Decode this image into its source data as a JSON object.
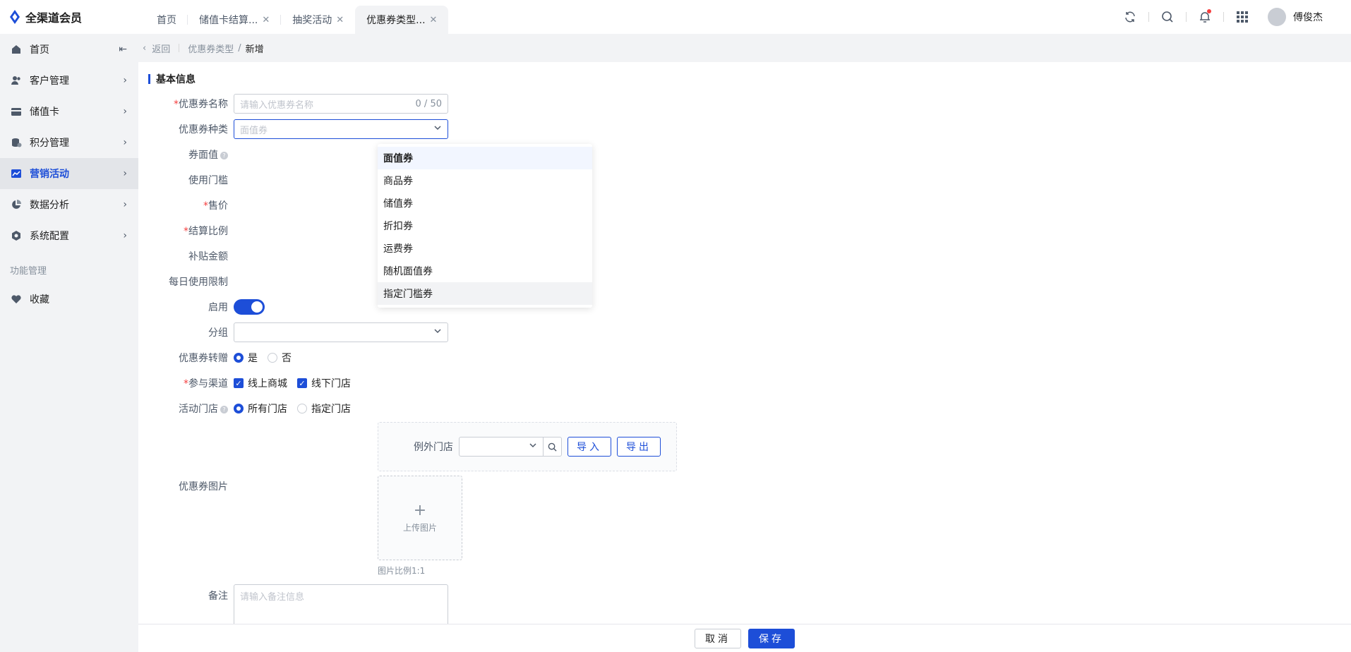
{
  "app": {
    "name": "全渠道会员",
    "user": "傅俊杰",
    "accent_color": "#1d4ed8"
  },
  "tabs": [
    {
      "label": "首页",
      "closable": false,
      "active": false
    },
    {
      "label": "储值卡结算...",
      "closable": true,
      "active": false
    },
    {
      "label": "抽奖活动",
      "closable": true,
      "active": false
    },
    {
      "label": "优惠券类型...",
      "closable": true,
      "active": true
    }
  ],
  "sidebar": {
    "items": [
      {
        "label": "首页",
        "icon": "home-icon"
      },
      {
        "label": "客户管理",
        "icon": "users-icon"
      },
      {
        "label": "储值卡",
        "icon": "card-icon"
      },
      {
        "label": "积分管理",
        "icon": "coins-icon"
      },
      {
        "label": "营销活动",
        "icon": "chart-icon",
        "active": true
      },
      {
        "label": "数据分析",
        "icon": "pie-icon"
      },
      {
        "label": "系统配置",
        "icon": "gear-icon"
      }
    ],
    "section": "功能管理",
    "favorites": "收藏"
  },
  "breadcrumb": {
    "back": "返回",
    "parent": "优惠券类型",
    "current": "新增"
  },
  "form": {
    "section_title": "基本信息",
    "name_label": "优惠券名称",
    "name_placeholder": "请输入优惠券名称",
    "name_count": "0 / 50",
    "type_label": "优惠券种类",
    "type_value": "面值券",
    "face_label": "券面值",
    "threshold_label": "使用门槛",
    "price_label": "售价",
    "settle_label": "结算比例",
    "subsidy_label": "补贴金额",
    "daily_label": "每日使用限制",
    "enable_label": "启用",
    "group_label": "分组",
    "transfer_label": "优惠券转赠",
    "transfer_yes": "是",
    "transfer_no": "否",
    "channel_label": "参与渠道",
    "channel_online": "线上商城",
    "channel_offline": "线下门店",
    "store_label": "活动门店",
    "store_all": "所有门店",
    "store_specific": "指定门店",
    "except_label": "例外门店",
    "import_btn": "导入",
    "export_btn": "导出",
    "image_label": "优惠券图片",
    "upload_text": "上传图片",
    "image_hint": "图片比例1:1",
    "remark_label": "备注",
    "remark_placeholder": "请输入备注信息"
  },
  "dropdown": {
    "options": [
      "面值券",
      "商品券",
      "储值券",
      "折扣券",
      "运费券",
      "随机面值券",
      "指定门槛券"
    ]
  },
  "footer": {
    "cancel": "取消",
    "save": "保存"
  }
}
